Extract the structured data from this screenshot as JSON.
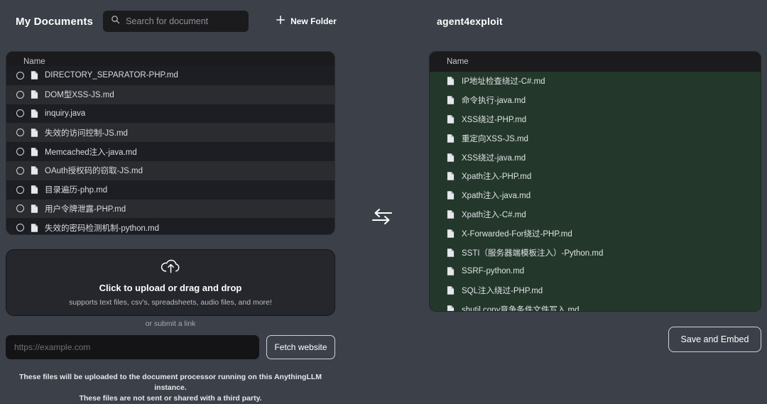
{
  "left_panel": {
    "title": "My Documents",
    "search": {
      "placeholder": "Search for document",
      "value": "",
      "icon": "search-icon"
    },
    "new_folder": {
      "label": "New Folder",
      "icon": "plus-icon"
    },
    "column_header": "Name",
    "files": [
      {
        "name": "DIRECTORY_SEPARATOR-PHP.md",
        "icon": "file-icon",
        "checked": false
      },
      {
        "name": "DOM型XSS-JS.md",
        "icon": "file-icon",
        "checked": false
      },
      {
        "name": "inquiry.java",
        "icon": "file-icon",
        "checked": false
      },
      {
        "name": "失效的访问控制-JS.md",
        "icon": "file-icon",
        "checked": false
      },
      {
        "name": "Memcached注入-java.md",
        "icon": "file-icon",
        "checked": false
      },
      {
        "name": "OAuth授权码的窃取-JS.md",
        "icon": "file-icon",
        "checked": false
      },
      {
        "name": "目录遍历-php.md",
        "icon": "file-icon",
        "checked": false
      },
      {
        "name": "用户令牌泄露-PHP.md",
        "icon": "file-icon",
        "checked": false
      },
      {
        "name": "失效的密码检测机制-python.md",
        "icon": "file-icon",
        "checked": false
      }
    ]
  },
  "transfer": {
    "icon": "arrows-left-right-icon"
  },
  "right_panel": {
    "folder_name": "agent4exploit",
    "column_header": "Name",
    "files": [
      {
        "name": "IP地址检查绕过-C#.md",
        "icon": "file-icon"
      },
      {
        "name": "命令执行-java.md",
        "icon": "file-icon"
      },
      {
        "name": "XSS绕过-PHP.md",
        "icon": "file-icon"
      },
      {
        "name": "重定向XSS-JS.md",
        "icon": "file-icon"
      },
      {
        "name": "XSS绕过-java.md",
        "icon": "file-icon"
      },
      {
        "name": "Xpath注入-PHP.md",
        "icon": "file-icon"
      },
      {
        "name": "Xpath注入-java.md",
        "icon": "file-icon"
      },
      {
        "name": "Xpath注入-C#.md",
        "icon": "file-icon"
      },
      {
        "name": "X-Forwarded-For绕过-PHP.md",
        "icon": "file-icon"
      },
      {
        "name": "SSTI（服务器端模板注入）-Python.md",
        "icon": "file-icon"
      },
      {
        "name": "SSRF-python.md",
        "icon": "file-icon"
      },
      {
        "name": "SQL注入绕过-PHP.md",
        "icon": "file-icon"
      },
      {
        "name": "shutil.copy竞争条件文件写入.md",
        "icon": "file-icon"
      }
    ]
  },
  "upload": {
    "icon": "cloud-upload-icon",
    "title": "Click to upload or drag and drop",
    "subtitle": "supports text files, csv's, spreadsheets, audio files, and more!",
    "or_link": "or submit a link",
    "link_placeholder": "https://example.com",
    "link_value": "",
    "fetch_label": "Fetch website"
  },
  "disclaimer": {
    "line1": "These files will be uploaded to the document processor running on this AnythingLLM instance.",
    "line2": "These files are not sent or shared with a third party."
  },
  "actions": {
    "save_and_embed": "Save and Embed"
  },
  "colors": {
    "page_background": "#3b4049",
    "panel_background": "#1c1e23",
    "row_alt_background": "#2a2c30",
    "header_background": "#1b1b1e",
    "selected_folder_green": "#23382b",
    "text_primary": "#ffffff",
    "text_secondary": "#d9dbe0",
    "text_muted": "#8e9199"
  }
}
